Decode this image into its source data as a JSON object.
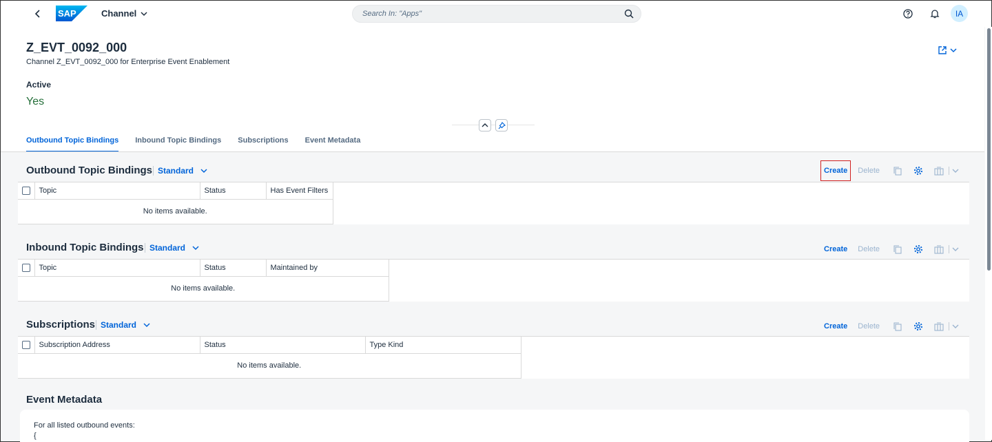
{
  "shell": {
    "logo_text": "SAP",
    "app_title": "Channel",
    "search_placeholder": "Search In: \"Apps\"",
    "avatar_initials": "IA"
  },
  "header": {
    "title": "Z_EVT_0092_000",
    "subtitle": "Channel Z_EVT_0092_000 for Enterprise Event Enablement",
    "attr_label": "Active",
    "attr_value": "Yes",
    "attr_value_color": "#256f3a"
  },
  "tabs": [
    {
      "label": "Outbound Topic Bindings",
      "active": true
    },
    {
      "label": "Inbound Topic Bindings",
      "active": false
    },
    {
      "label": "Subscriptions",
      "active": false
    },
    {
      "label": "Event Metadata",
      "active": false
    }
  ],
  "toolbar": {
    "create_label": "Create",
    "delete_label": "Delete"
  },
  "sections": {
    "outbound": {
      "title": "Outbound Topic Bindings",
      "variant": "Standard",
      "columns": [
        "Topic",
        "Status",
        "Has Event Filters"
      ],
      "empty_text": "No items available."
    },
    "inbound": {
      "title": "Inbound Topic Bindings",
      "variant": "Standard",
      "columns": [
        "Topic",
        "Status",
        "Maintained by"
      ],
      "empty_text": "No items available."
    },
    "subscriptions": {
      "title": "Subscriptions",
      "variant": "Standard",
      "columns": [
        "Subscription Address",
        "Status",
        "Type Kind"
      ],
      "empty_text": "No items available."
    },
    "metadata": {
      "title": "Event Metadata",
      "line1": "For all listed outbound events:",
      "line2": "{"
    }
  },
  "icons": {
    "back": "chevron-left-icon",
    "search": "search-icon",
    "help": "help-icon",
    "notifications": "bell-icon",
    "share": "share-icon",
    "collapse": "chevron-up-icon",
    "pin": "pin-icon",
    "copy": "copy-icon",
    "settings": "gear-icon",
    "export": "export-icon"
  },
  "colors": {
    "accent": "#0064d9",
    "highlight": "#d02020"
  }
}
